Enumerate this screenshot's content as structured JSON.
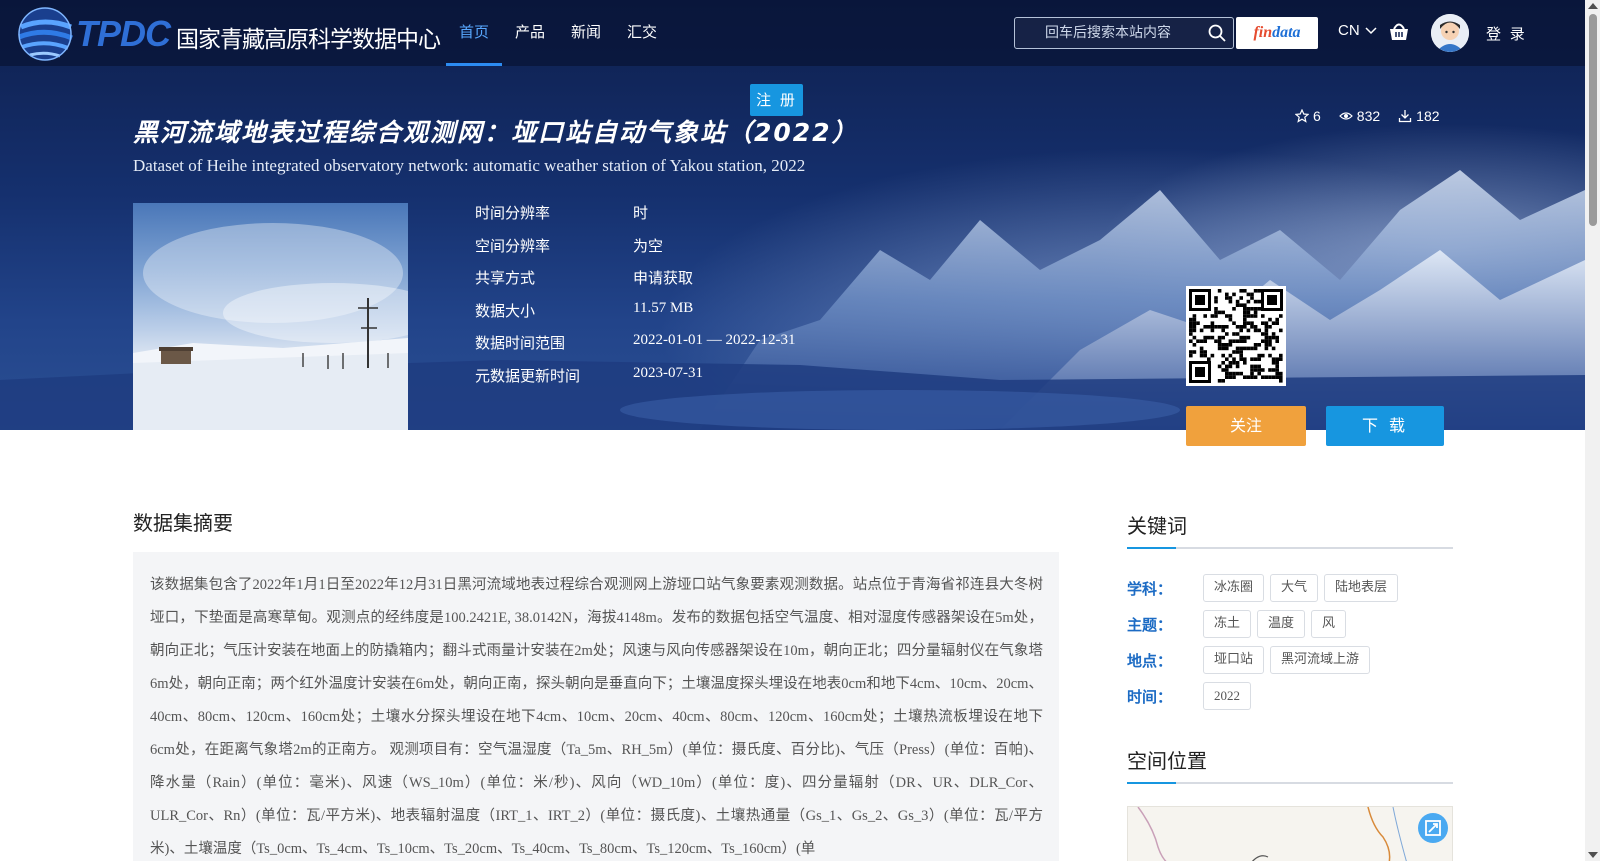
{
  "header": {
    "logo_text": "TPDC",
    "logo_title": "国家青藏高原科学数据中心",
    "nav": [
      {
        "label": "首页",
        "active": true
      },
      {
        "label": "产品",
        "active": false
      },
      {
        "label": "新闻",
        "active": false
      },
      {
        "label": "汇交",
        "active": false
      }
    ],
    "search_placeholder": "回车后搜索本站内容",
    "findata_a": "fin",
    "findata_b": "data",
    "language": "CN",
    "login_label": "登 录",
    "register_label": "注 册"
  },
  "dataset": {
    "title_cn": "黑河流域地表过程综合观测网：垭口站自动气象站（2022）",
    "title_en": "Dataset of Heihe integrated observatory network: automatic weather station of Yakou station, 2022",
    "stats": {
      "stars": "6",
      "views": "832",
      "downloads": "182"
    },
    "meta": [
      {
        "label": "时间分辨率",
        "value": "时"
      },
      {
        "label": "空间分辨率",
        "value": "为空"
      },
      {
        "label": "共享方式",
        "value": "申请获取"
      },
      {
        "label": "数据大小",
        "value": "11.57 MB"
      },
      {
        "label": "数据时间范围",
        "value": "2022-01-01 — 2022-12-31"
      },
      {
        "label": "元数据更新时间",
        "value": "2023-07-31"
      }
    ],
    "follow_label": "关注",
    "download_label": "下 载"
  },
  "abstract": {
    "title": "数据集摘要",
    "text": "该数据集包含了2022年1月1日至2022年12月31日黑河流域地表过程综合观测网上游垭口站气象要素观测数据。站点位于青海省祁连县大冬树垭口，下垫面是高寒草甸。观测点的经纬度是100.2421E, 38.0142N，海拔4148m。发布的数据包括空气温度、相对湿度传感器架设在5m处，朝向正北；气压计安装在地面上的防撬箱内；翻斗式雨量计安装在2m处；风速与风向传感器架设在10m，朝向正北；四分量辐射仪在气象塔6m处，朝向正南；两个红外温度计安装在6m处，朝向正南，探头朝向是垂直向下；土壤温度探头埋设在地表0cm和地下4cm、10cm、20cm、40cm、80cm、120cm、160cm处；土壤水分探头埋设在地下4cm、10cm、20cm、40cm、80cm、120cm、160cm处；土壤热流板埋设在地下6cm处，在距离气象塔2m的正南方。 观测项目有：空气温湿度（Ta_5m、RH_5m）(单位：摄氏度、百分比)、气压（Press）(单位：百帕)、降水量（Rain）(单位：毫米)、风速（WS_10m）(单位：米/秒)、风向（WD_10m）(单位：度)、四分量辐射（DR、UR、DLR_Cor、ULR_Cor、Rn）(单位：瓦/平方米)、地表辐射温度（IRT_1、IRT_2）(单位：摄氏度)、土壤热通量（Gs_1、Gs_2、Gs_3）(单位：瓦/平方米)、土壤温度（Ts_0cm、Ts_4cm、Ts_10cm、Ts_20cm、Ts_40cm、Ts_80cm、Ts_120cm、Ts_160cm）(单"
  },
  "keywords": {
    "title": "关键词",
    "rows": [
      {
        "label": "学科：",
        "tags": [
          "冰冻圈",
          "大气",
          "陆地表层"
        ]
      },
      {
        "label": "主题：",
        "tags": [
          "冻土",
          "温度",
          "风"
        ]
      },
      {
        "label": "地点：",
        "tags": [
          "垭口站",
          "黑河流域上游"
        ]
      },
      {
        "label": "时间：",
        "tags": [
          "2022"
        ]
      }
    ]
  },
  "location": {
    "title": "空间位置"
  },
  "colors": {
    "accent": "#1796e0",
    "follow": "#f0a13d",
    "nav_active": "#58a8ff",
    "keyword_label": "#1c6bc4"
  }
}
